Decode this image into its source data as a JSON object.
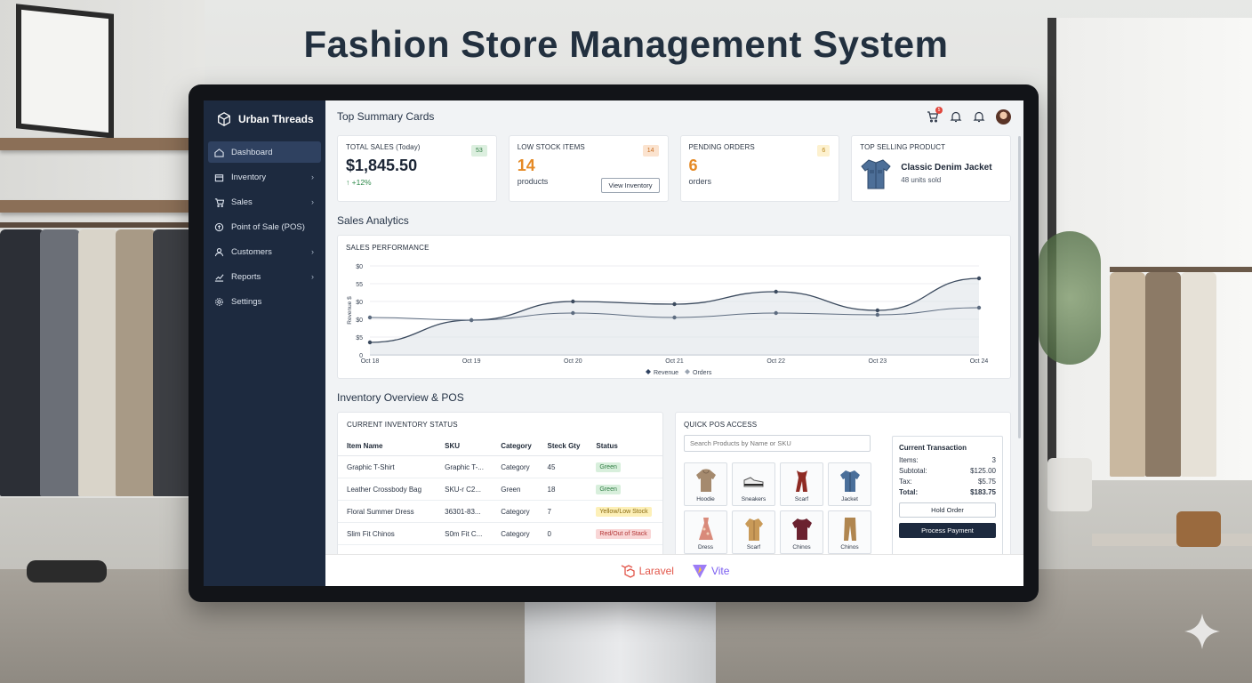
{
  "page_title": "Fashion Store Management System",
  "app": {
    "brand": "Urban Threads"
  },
  "sidebar": {
    "items": [
      {
        "label": "Dashboard",
        "icon": "dashboard-icon",
        "chevron": false,
        "active": true
      },
      {
        "label": "Inventory",
        "icon": "box-icon",
        "chevron": true,
        "active": false
      },
      {
        "label": "Sales",
        "icon": "cart-icon",
        "chevron": true,
        "active": false
      },
      {
        "label": "Point of Sale (POS)",
        "icon": "pos-icon",
        "chevron": false,
        "active": false
      },
      {
        "label": "Customers",
        "icon": "user-icon",
        "chevron": true,
        "active": false
      },
      {
        "label": "Reports",
        "icon": "chart-icon",
        "chevron": true,
        "active": false
      },
      {
        "label": "Settings",
        "icon": "gear-icon",
        "chevron": false,
        "active": false
      }
    ]
  },
  "header": {
    "title": "Top Summary Cards",
    "cart_badge": "5"
  },
  "cards": {
    "sales": {
      "label": "TOTAL SALES (Today)",
      "value": "$1,845.50",
      "trend": "+12%",
      "badge": "53"
    },
    "low_stock": {
      "label": "LOW STOCK ITEMS",
      "value": "14",
      "sub": "products",
      "badge": "14",
      "button": "View Inventory"
    },
    "pending": {
      "label": "PENDING ORDERS",
      "value": "6",
      "sub": "orders",
      "badge": "6"
    },
    "top_product": {
      "label": "TOP SELLING PRODUCT",
      "name": "Classic Denim Jacket",
      "sub": "48 units sold"
    }
  },
  "analytics": {
    "section_title": "Sales Analytics",
    "panel_title": "SALES PERFORMANCE"
  },
  "chart_data": {
    "type": "line",
    "title": "SALES PERFORMANCE",
    "ylabel": "Revenue $",
    "y_tick_labels": [
      "$0",
      "55",
      "$0",
      "$0",
      "$5",
      "0"
    ],
    "categories": [
      "Oct 18",
      "Oct 19",
      "Oct 20",
      "Oct 21",
      "Oct 22",
      "Oct 23",
      "Oct 24"
    ],
    "ylim": [
      0,
      100
    ],
    "series": [
      {
        "name": "Revenue",
        "values": [
          14,
          39,
          60,
          57,
          71,
          50,
          86
        ],
        "color": "#3b4a5e"
      },
      {
        "name": "Orders",
        "values": [
          42,
          39,
          47,
          42,
          47,
          45,
          53
        ],
        "color": "#5d6c80"
      }
    ],
    "legend": "bottom-center",
    "grid": true
  },
  "inventory": {
    "section_title": "Inventory Overview & POS",
    "panel_title": "CURRENT INVENTORY STATUS",
    "columns": [
      "Item Name",
      "SKU",
      "Category",
      "Steck Gty",
      "Status"
    ],
    "rows": [
      {
        "name": "Graphic T-Shirt",
        "sku": "Graphic T-...",
        "category": "Category",
        "qty": "45",
        "status": "Green",
        "status_type": "green"
      },
      {
        "name": "Leather Crossbody Bag",
        "sku": "SKU-r C2...",
        "category": "Green",
        "qty": "18",
        "status": "Green",
        "status_type": "green"
      },
      {
        "name": "Floral Summer Dress",
        "sku": "36301-83...",
        "category": "Category",
        "qty": "7",
        "status": "Yellow/Low Stock",
        "status_type": "yellow"
      },
      {
        "name": "Slim Fit Chinos",
        "sku": "S0m Fit C...",
        "category": "Category",
        "qty": "0",
        "status": "Red/Out of Stack",
        "status_type": "red"
      }
    ]
  },
  "pos": {
    "panel_title": "QUICK POS ACCESS",
    "search_placeholder": "Search Products by Name or SKU",
    "tiles": [
      {
        "label": "Hoodie",
        "icon": "hoodie-icon",
        "color": "#a58a6e"
      },
      {
        "label": "Sneakers",
        "icon": "sneaker-icon",
        "color": "#d8d8d8"
      },
      {
        "label": "Scarf",
        "icon": "scarf-icon",
        "color": "#8f2b24"
      },
      {
        "label": "Jacket",
        "icon": "jacket-icon",
        "color": "#4a6f9a"
      },
      {
        "label": "Dress",
        "icon": "dress-icon",
        "color": "#d98a7a"
      },
      {
        "label": "Scarf",
        "icon": "coat-icon",
        "color": "#c99a58"
      },
      {
        "label": "Chinos",
        "icon": "sweater-icon",
        "color": "#6b2230"
      },
      {
        "label": "Chinos",
        "icon": "pants-icon",
        "color": "#b08650"
      }
    ],
    "transaction": {
      "title": "Current Transaction",
      "items_label": "Items:",
      "items_value": "3",
      "subtotal_label": "Subtotal:",
      "subtotal_value": "$125.00",
      "tax_label": "Tax:",
      "tax_value": "$5.75",
      "total_label": "Total:",
      "total_value": "$183.75",
      "hold_button": "Hold Order",
      "pay_button": "Process Payment"
    }
  },
  "footer": {
    "laravel": "Laravel",
    "vite": "Vite"
  }
}
